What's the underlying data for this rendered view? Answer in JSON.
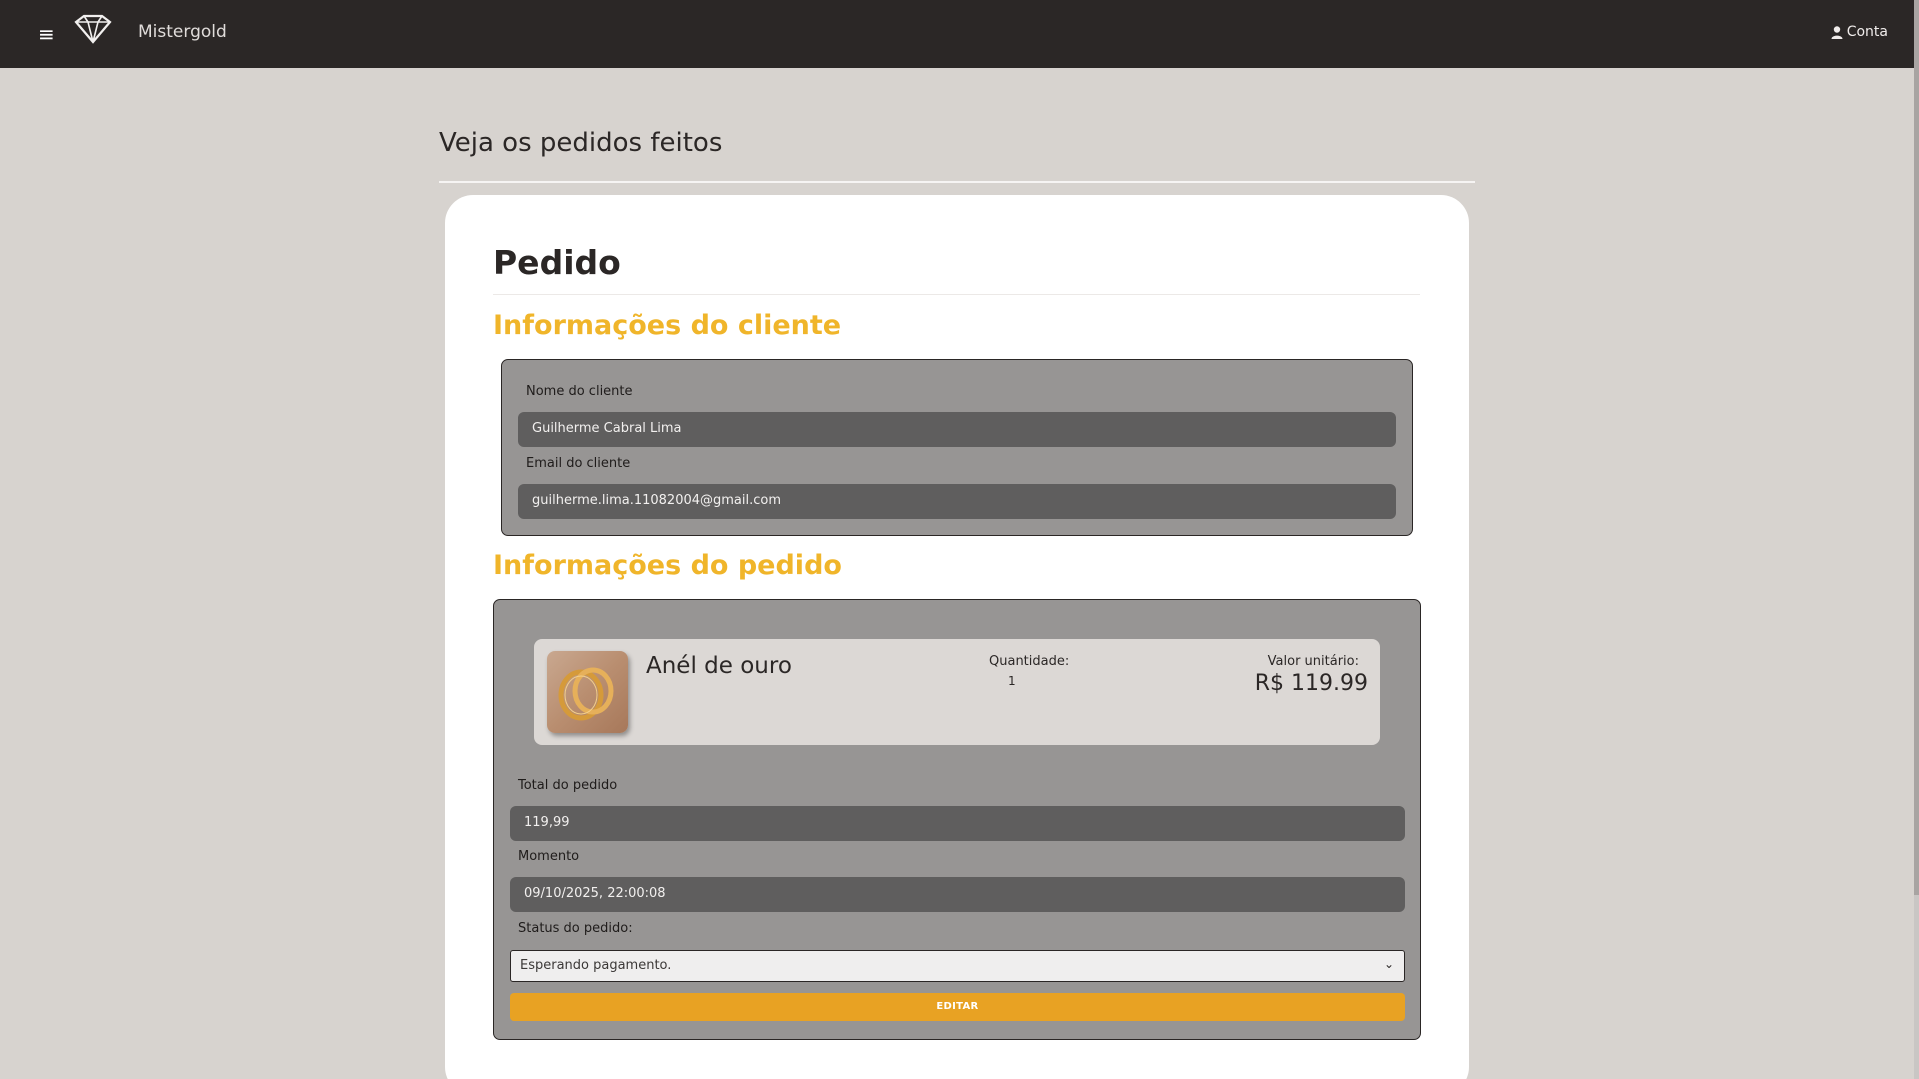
{
  "header": {
    "menu_icon": "hamburger-icon",
    "logo_icon": "diamond-icon",
    "brand": "Mistergold",
    "account_icon": "user-icon",
    "account_label": "Conta"
  },
  "page": {
    "title": "Veja os pedidos feitos"
  },
  "order": {
    "title": "Pedido",
    "client_section": "Informações do cliente",
    "client_name_label": "Nome do cliente",
    "client_name": "Guilherme Cabral Lima",
    "client_email_label": "Email do cliente",
    "client_email": "guilherme.lima.11082004@gmail.com",
    "order_section": "Informações do pedido",
    "items": [
      {
        "name": "Anél de ouro",
        "quantity_label": "Quantidade:",
        "quantity": "1",
        "unit_price_label": "Valor unitário:",
        "unit_price": "R$ 119.99"
      }
    ],
    "total_label": "Total do pedido",
    "total": "119,99",
    "moment_label": "Momento",
    "moment": "09/10/2025, 22:00:08",
    "status_label": "Status do pedido:",
    "status": "Esperando pagamento.",
    "edit_button": "EDITAR"
  },
  "colors": {
    "header_bg": "#2b2726",
    "page_bg": "#d7d3cf",
    "accent": "#f0b52a",
    "button": "#e8a223",
    "field_bg": "#5f5e5e"
  }
}
